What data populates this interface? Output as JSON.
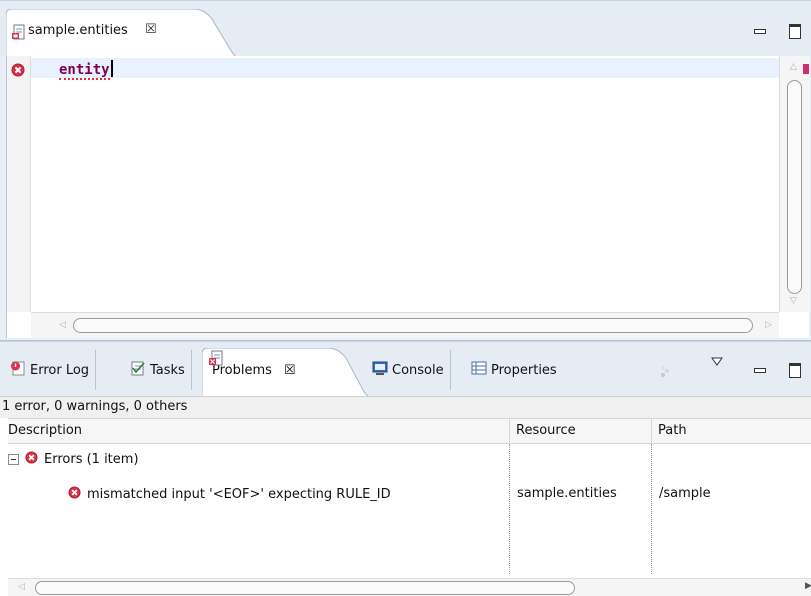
{
  "editor": {
    "tab_label": "sample.entities",
    "tab_close_glyph": "☒",
    "code_keyword": "entity"
  },
  "views": {
    "tabs": [
      {
        "label": "Error Log",
        "icon": "error-log-icon"
      },
      {
        "label": "Tasks",
        "icon": "tasks-icon"
      },
      {
        "label": "Problems",
        "icon": "problems-icon",
        "active": true
      },
      {
        "label": "Console",
        "icon": "console-icon"
      },
      {
        "label": "Properties",
        "icon": "properties-icon"
      }
    ],
    "tab_close_glyph": "☒"
  },
  "problems": {
    "status": "1 error, 0 warnings, 0 others",
    "columns": [
      "Description",
      "Resource",
      "Path"
    ],
    "group_label": "Errors (1 item)",
    "rows": [
      {
        "description": "mismatched input '<EOF>' expecting RULE_ID",
        "resource": "sample.entities",
        "path": "/sample"
      }
    ]
  },
  "colors": {
    "error_red": "#d9324a",
    "keyword": "#7f0055",
    "tab_bar": "#e6ecf4"
  }
}
